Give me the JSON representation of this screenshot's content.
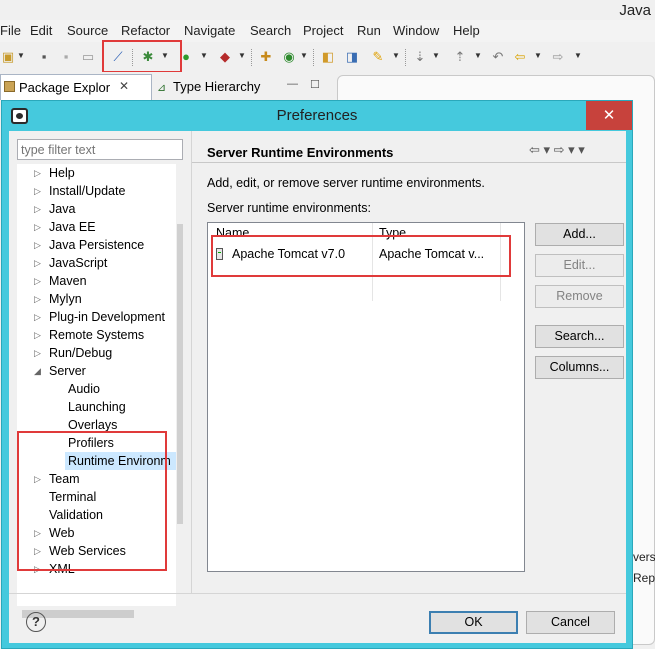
{
  "window": {
    "title_partial": "Java"
  },
  "menubar": [
    "File",
    "Edit",
    "Source",
    "Refactor",
    "Navigate",
    "Search",
    "Project",
    "Run",
    "Window",
    "Help"
  ],
  "views": {
    "package_explorer_tab": "Package Explor",
    "type_hierarchy_tab": "Type Hierarchy",
    "close_glyph": "✕",
    "minimize_glyph": "—",
    "maximize_glyph": "☐"
  },
  "background_peek": [
    "vers",
    "Rep"
  ],
  "dialog": {
    "title": "Preferences",
    "close_glyph": "✕",
    "filter_placeholder": "type filter text",
    "tree": [
      {
        "label": "Help",
        "level": 0,
        "expandable": true
      },
      {
        "label": "Install/Update",
        "level": 0,
        "expandable": true
      },
      {
        "label": "Java",
        "level": 0,
        "expandable": true
      },
      {
        "label": "Java EE",
        "level": 0,
        "expandable": true
      },
      {
        "label": "Java Persistence",
        "level": 0,
        "expandable": true
      },
      {
        "label": "JavaScript",
        "level": 0,
        "expandable": true
      },
      {
        "label": "Maven",
        "level": 0,
        "expandable": true
      },
      {
        "label": "Mylyn",
        "level": 0,
        "expandable": true
      },
      {
        "label": "Plug-in Development",
        "level": 0,
        "expandable": true
      },
      {
        "label": "Remote Systems",
        "level": 0,
        "expandable": true
      },
      {
        "label": "Run/Debug",
        "level": 0,
        "expandable": true
      },
      {
        "label": "Server",
        "level": 0,
        "expandable": true,
        "expanded": true
      },
      {
        "label": "Audio",
        "level": 1,
        "expandable": false
      },
      {
        "label": "Launching",
        "level": 1,
        "expandable": false
      },
      {
        "label": "Overlays",
        "level": 1,
        "expandable": false
      },
      {
        "label": "Profilers",
        "level": 1,
        "expandable": false
      },
      {
        "label": "Runtime Environm",
        "level": 1,
        "expandable": false,
        "selected": true
      },
      {
        "label": "Team",
        "level": 0,
        "expandable": true
      },
      {
        "label": "Terminal",
        "level": 0,
        "expandable": false
      },
      {
        "label": "Validation",
        "level": 0,
        "expandable": false
      },
      {
        "label": "Web",
        "level": 0,
        "expandable": true
      },
      {
        "label": "Web Services",
        "level": 0,
        "expandable": true
      },
      {
        "label": "XML",
        "level": 0,
        "expandable": true
      }
    ],
    "page": {
      "title": "Server Runtime Environments",
      "nav_glyphs": "⇦ ▾  ⇨ ▾  ▾",
      "description": "Add, edit, or remove server runtime environments.",
      "table_label": "Server runtime environments:",
      "columns": [
        "Name",
        "Type"
      ],
      "rows": [
        {
          "name": "Apache Tomcat v7.0",
          "type": "Apache Tomcat v..."
        }
      ],
      "buttons": {
        "add": "Add...",
        "edit": "Edit...",
        "remove": "Remove",
        "search": "Search...",
        "columns": "Columns..."
      }
    },
    "help_glyph": "?",
    "ok": "OK",
    "cancel": "Cancel"
  },
  "accent_colors": {
    "highlight": "#e03a3a",
    "dialog_frame": "#45c9dd",
    "close": "#c7423c"
  }
}
